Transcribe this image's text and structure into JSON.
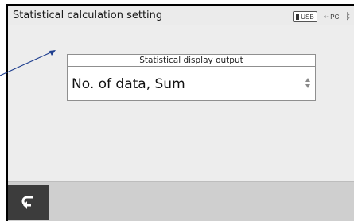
{
  "window": {
    "title": "Statistical calculation setting"
  },
  "status_bar": {
    "usb_label": "USB",
    "pc_label": "PC",
    "icons": [
      "usb-icon",
      "pc-connection-icon",
      "bluetooth-icon"
    ]
  },
  "setting": {
    "label": "Statistical display output",
    "value": "No. of data, Sum"
  },
  "footer": {
    "back_icon": "back-return-icon"
  },
  "colors": {
    "titlebar": "#ebebeb",
    "panel": "#ededed",
    "footer": "#cfcfcf",
    "back_button": "#3c3c3c",
    "callout_arrow": "#1f3f8f"
  }
}
